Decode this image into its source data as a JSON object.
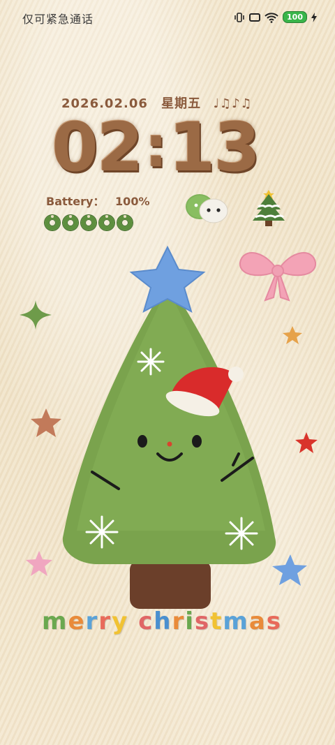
{
  "status_bar": {
    "carrier_text": "仅可紧急通话",
    "battery_badge": "100",
    "icons": [
      "vibrate-icon",
      "nfc-icon",
      "wifi-icon",
      "battery-icon",
      "charging-bolt-icon"
    ]
  },
  "lockscreen": {
    "date": "2026.02.06",
    "weekday": "星期五",
    "music_notes": "♩♫♪♫",
    "time": {
      "h1": "0",
      "h2": "2",
      "sep": ":",
      "m1": "1",
      "m2": "3"
    },
    "battery_label": "Battery：",
    "battery_value": "100%",
    "battery_wreaths_filled": 5
  },
  "decor": {
    "greeting": [
      "m",
      "e",
      "r",
      "r",
      "y",
      " ",
      "c",
      "h",
      "r",
      "i",
      "s",
      "t",
      "m",
      "a",
      "s"
    ],
    "greeting_colors": [
      "#6aa84f",
      "#e98b3a",
      "#5aa2d8",
      "#e86a5a",
      "#f1c232",
      "#000000",
      "#e06666",
      "#4a8fcf",
      "#e98b3a",
      "#6aa84f",
      "#e06666",
      "#f1c232",
      "#5aa2d8",
      "#e98b3a",
      "#e86a5a"
    ],
    "colors": {
      "clock_brown": "#9b6a45",
      "tree_green": "#7aa34d",
      "star_blue": "#6fa0e0",
      "bow_pink": "#f3a3b6",
      "santa_red": "#d92b2b"
    }
  }
}
